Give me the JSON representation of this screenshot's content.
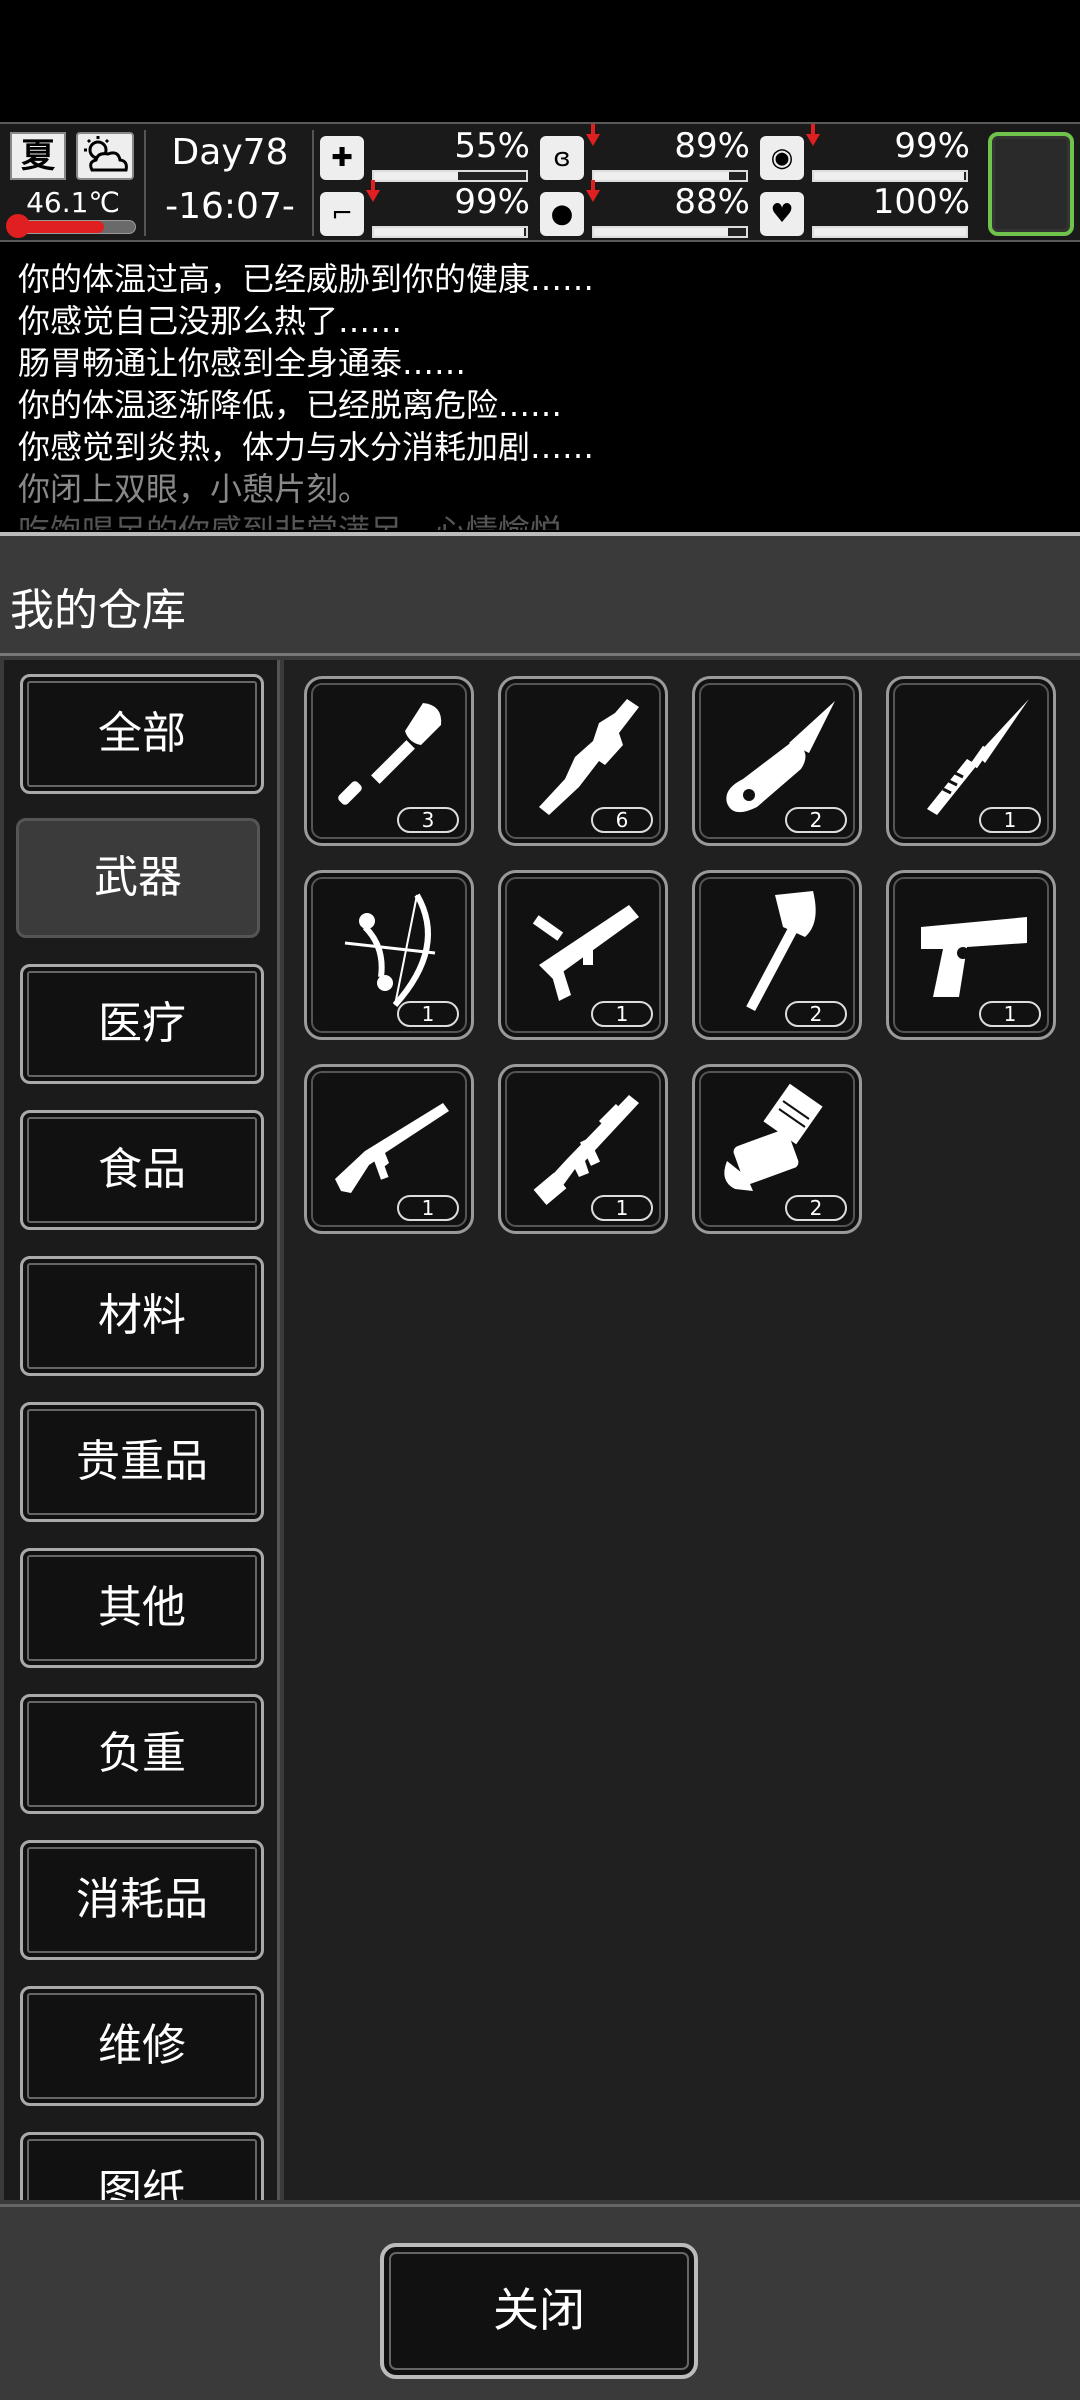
{
  "hud": {
    "season": "夏",
    "weather_icon": "partly-cloudy-icon",
    "temperature": "46.1℃",
    "temperature_level": 0.75,
    "day": "Day78",
    "time": "-16:07-",
    "stats": [
      {
        "icon": "medkit-icon",
        "value": "55%",
        "fill": 0.55,
        "falling": false
      },
      {
        "icon": "stomach-icon",
        "value": "89%",
        "fill": 0.89,
        "falling": true
      },
      {
        "icon": "brain-icon",
        "value": "99%",
        "fill": 0.99,
        "falling": true
      },
      {
        "icon": "boot-icon",
        "value": "99%",
        "fill": 0.99,
        "falling": true
      },
      {
        "icon": "water-drop-icon",
        "value": "88%",
        "fill": 0.88,
        "falling": true
      },
      {
        "icon": "heart-icon",
        "value": "100%",
        "fill": 1.0,
        "falling": false
      }
    ],
    "accent_color": "#6fc24a",
    "warning_color": "#e02020"
  },
  "log": [
    "你的体温过高，已经威胁到你的健康……",
    "你感觉自己没那么热了……",
    "肠胃畅通让你感到全身通泰……",
    "你的体温逐渐降低，已经脱离危险……",
    "你感觉到炎热，体力与水分消耗加剧……",
    "你闭上双眼，小憩片刻。",
    "吃饱喝足的你感到非常满足，心情愉悦……"
  ],
  "panel": {
    "title": "我的仓库",
    "categories": [
      "全部",
      "武器",
      "医疗",
      "食品",
      "材料",
      "贵重品",
      "其他",
      "负重",
      "消耗品",
      "维修",
      "图纸"
    ],
    "selected_category": "武器",
    "items": [
      {
        "icon": "shovel-icon",
        "count": "3"
      },
      {
        "icon": "wooden-club-icon",
        "count": "6"
      },
      {
        "icon": "folding-knife-icon",
        "count": "2"
      },
      {
        "icon": "combat-knife-icon",
        "count": "1"
      },
      {
        "icon": "compound-bow-icon",
        "count": "1"
      },
      {
        "icon": "nail-gun-icon",
        "count": "1"
      },
      {
        "icon": "axe-icon",
        "count": "2"
      },
      {
        "icon": "pistol-icon",
        "count": "1"
      },
      {
        "icon": "assault-rifle-icon",
        "count": "1"
      },
      {
        "icon": "tactical-rifle-icon",
        "count": "1"
      },
      {
        "icon": "minigun-icon",
        "count": "2"
      }
    ],
    "close_label": "关闭"
  }
}
